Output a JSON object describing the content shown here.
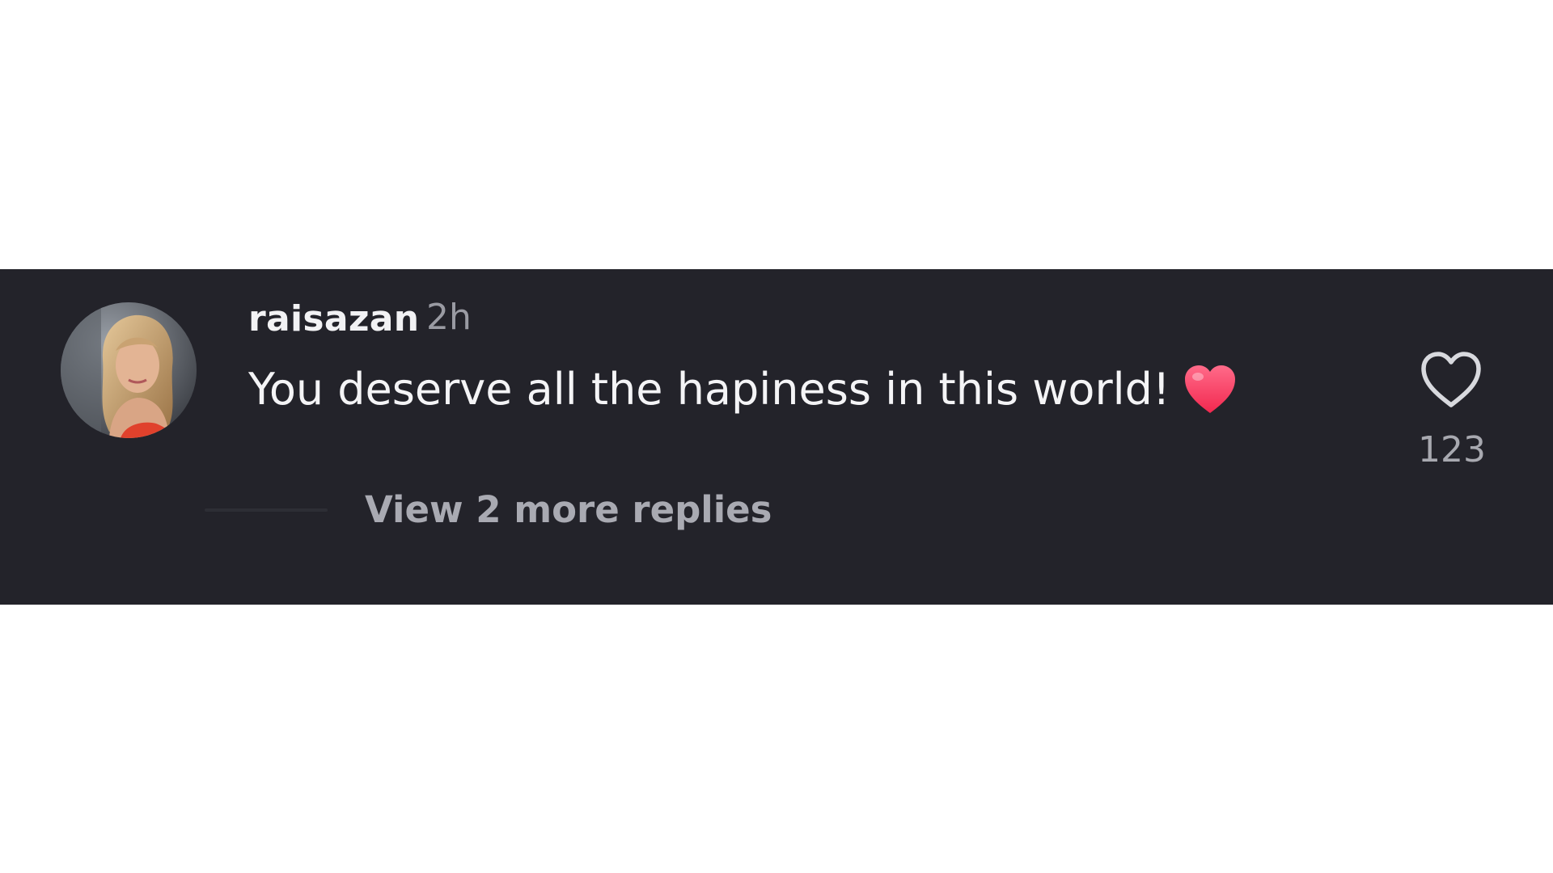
{
  "comment": {
    "username": "raisazan",
    "timestamp": "2h",
    "text": "You deserve all the hapiness in this world!",
    "text_emoji": "heart-emoji",
    "avatar": "profile-photo",
    "like_icon": "heart-outline-icon",
    "like_count": "123",
    "view_replies_label": "View 2 more replies"
  },
  "colors": {
    "panel_background": "#23232a",
    "page_background": "#ffffff",
    "username": "#f2f2f4",
    "secondary_text": "#9a9ba3",
    "emoji_heart": "#ff3d68"
  }
}
